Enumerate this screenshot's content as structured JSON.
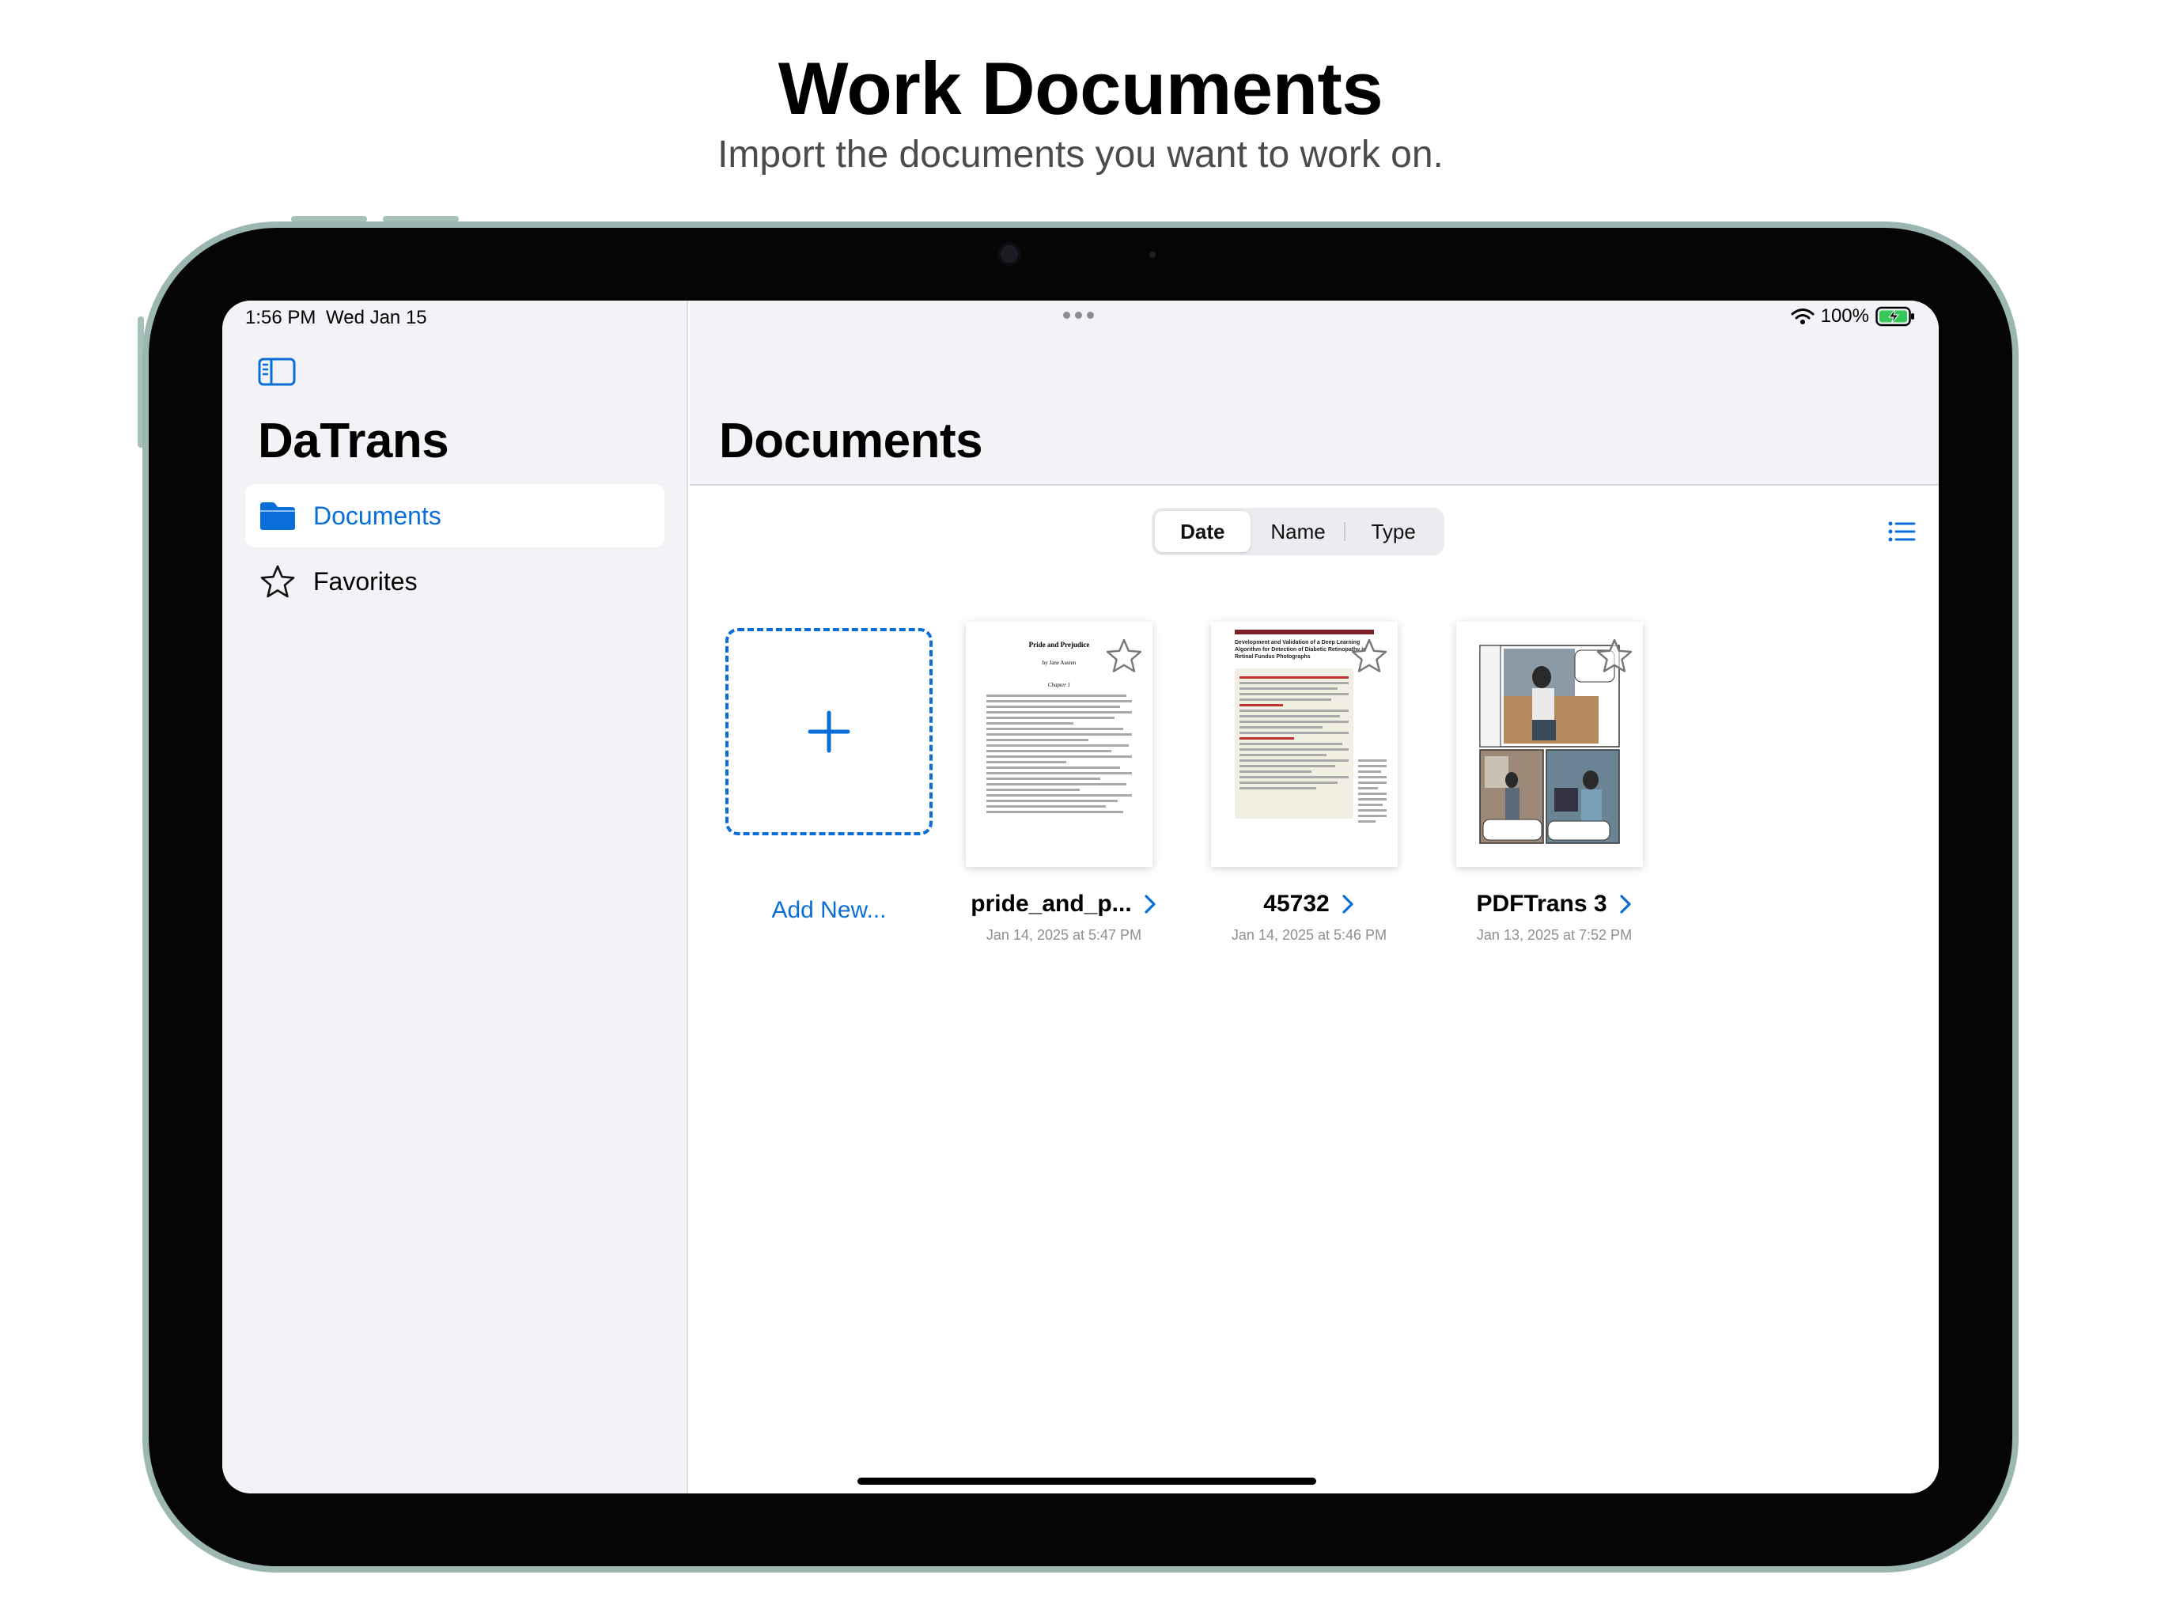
{
  "hero": {
    "title": "Work Documents",
    "subtitle": "Import the documents you want to work on."
  },
  "status_bar": {
    "time": "1:56 PM",
    "date": "Wed Jan 15",
    "battery": "100%"
  },
  "sidebar": {
    "app_title": "DaTrans",
    "items": [
      {
        "label": "Documents",
        "icon": "folder-icon",
        "selected": true
      },
      {
        "label": "Favorites",
        "icon": "star-icon",
        "selected": false
      }
    ]
  },
  "main": {
    "title": "Documents",
    "sort_segments": [
      {
        "label": "Date",
        "active": true
      },
      {
        "label": "Name",
        "active": false
      },
      {
        "label": "Type",
        "active": false
      }
    ],
    "add_label": "Add New...",
    "documents": [
      {
        "name": "pride_and_p...",
        "date": "Jan 14, 2025 at 5:47 PM",
        "thumb_title": "Pride and Prejudice",
        "thumb_author": "by Jane Austen",
        "thumb_chapter": "Chapter 1"
      },
      {
        "name": "45732",
        "date": "Jan 14, 2025 at 5:46 PM",
        "thumb_title": "Development and Validation of a Deep Learning Algorithm for Detection of Diabetic Retinopathy in Retinal Fundus Photographs"
      },
      {
        "name": "PDFTrans 3",
        "date": "Jan 13, 2025 at 7:52 PM"
      }
    ]
  },
  "colors": {
    "accent": "#0a6ed8",
    "sidebar_bg": "#f2f2f7",
    "secondary_text": "#8e8e93"
  }
}
